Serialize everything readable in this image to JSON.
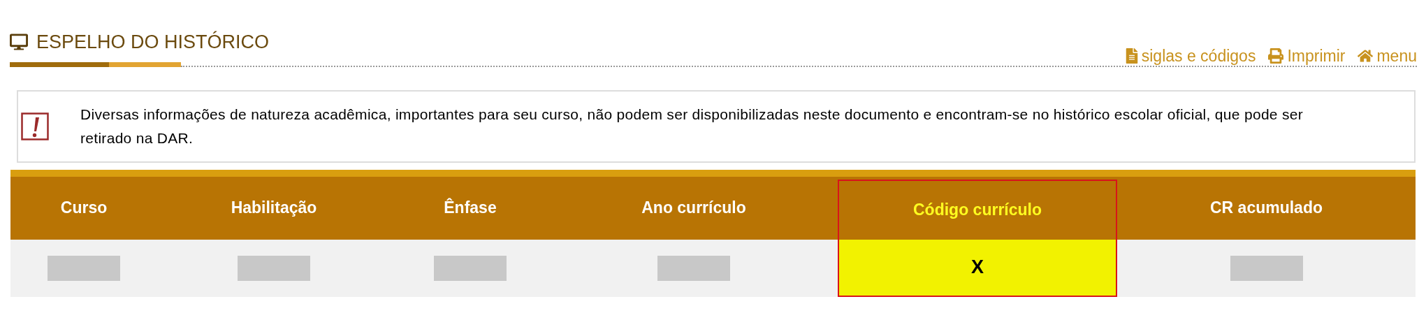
{
  "header": {
    "title": "ESPELHO DO HISTÓRICO",
    "links": [
      {
        "kind": "document",
        "label": "siglas e códigos"
      },
      {
        "kind": "print",
        "label": "Imprimir"
      },
      {
        "kind": "home",
        "label": "menu"
      }
    ]
  },
  "notice": {
    "text": "Diversas informações de natureza acadêmica, importantes para seu curso, não podem ser disponibilizadas neste documento e encontram-se no histórico escolar oficial, que pode ser retirado na DAR."
  },
  "table": {
    "columns": [
      {
        "label": "Curso",
        "highlighted": false
      },
      {
        "label": "Habilitação",
        "highlighted": false
      },
      {
        "label": "Ênfase",
        "highlighted": false
      },
      {
        "label": "Ano currículo",
        "highlighted": false
      },
      {
        "label": "Código currículo",
        "highlighted": true
      },
      {
        "label": "CR acumulado",
        "highlighted": false
      }
    ],
    "rows": [
      {
        "cells": [
          {
            "kind": "redacted"
          },
          {
            "kind": "redacted"
          },
          {
            "kind": "redacted"
          },
          {
            "kind": "redacted"
          },
          {
            "kind": "text",
            "text": "X"
          },
          {
            "kind": "redacted"
          }
        ]
      }
    ]
  }
}
